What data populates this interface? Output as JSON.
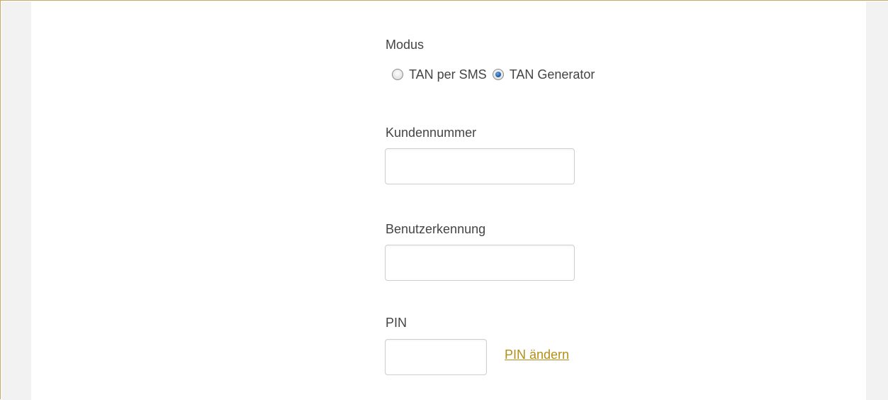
{
  "form": {
    "mode": {
      "label": "Modus",
      "options": [
        {
          "label": "TAN per SMS",
          "checked": false
        },
        {
          "label": "TAN Generator",
          "checked": true
        }
      ]
    },
    "customer_number": {
      "label": "Kundennummer",
      "value": ""
    },
    "user_id": {
      "label": "Benutzerkennung",
      "value": ""
    },
    "pin": {
      "label": "PIN",
      "value": ""
    },
    "change_pin_link": "PIN ändern"
  },
  "colors": {
    "frame_border": "#c8a96b",
    "link": "#b38f1a",
    "gutter": "#f2f2f2",
    "radio_selected": "#1e5fa8"
  }
}
